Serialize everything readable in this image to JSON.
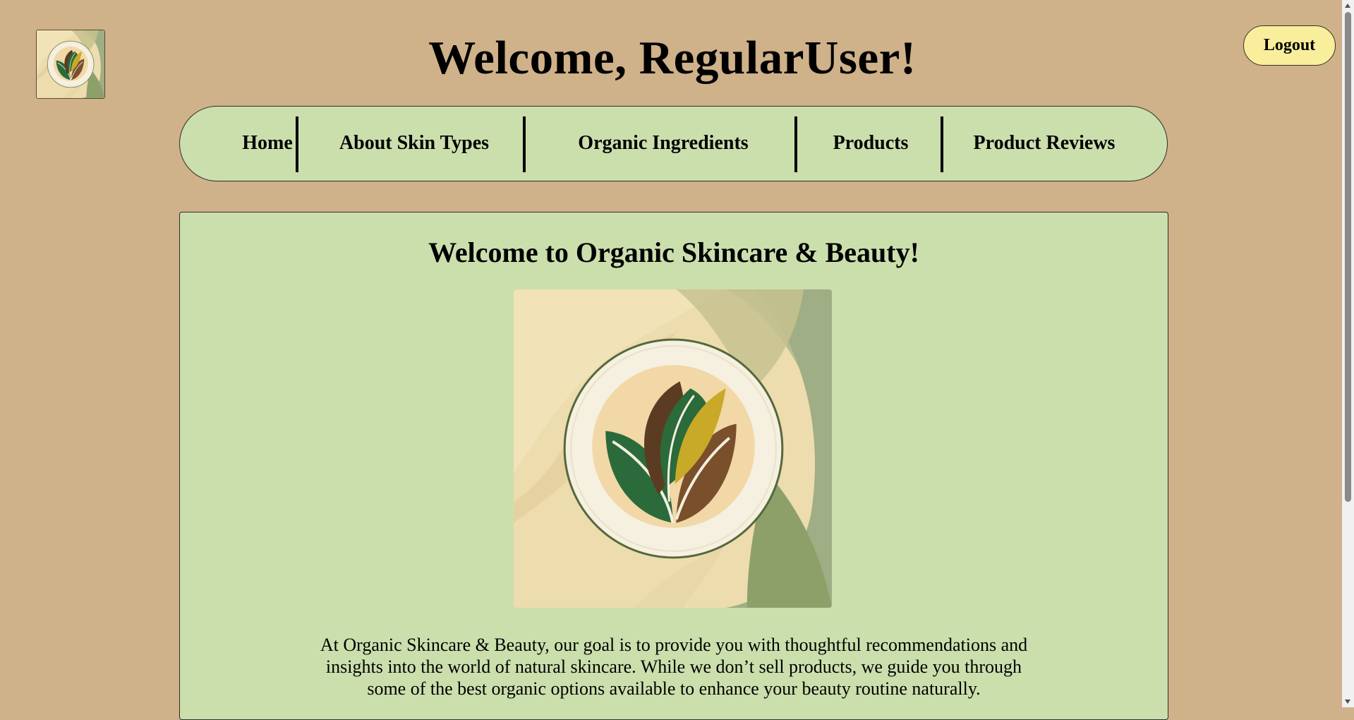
{
  "header": {
    "title": "Welcome, RegularUser!",
    "logout_label": "Logout",
    "logo_icon": "leaf-logo-icon"
  },
  "nav": {
    "items": [
      {
        "label": "Home"
      },
      {
        "label": "About Skin Types"
      },
      {
        "label": "Organic Ingredients"
      },
      {
        "label": "Products"
      },
      {
        "label": "Product Reviews"
      }
    ]
  },
  "main": {
    "heading": "Welcome to Organic Skincare & Beauty!",
    "hero_icon": "leaf-emblem-image",
    "intro_text": "At Organic Skincare & Beauty, our goal is to provide you with thoughtful recommendations and insights into the world of natural skincare. While we don’t sell products, we guide you through some of the best organic options available to enhance your beauty routine naturally."
  },
  "colors": {
    "page_background": "#cfb18a",
    "panel_background": "#cbdfad",
    "logout_button": "#f8ee9c",
    "leaf_green": "#2f6b3a",
    "leaf_brown": "#7a4f2b",
    "leaf_gold": "#c9a928"
  }
}
